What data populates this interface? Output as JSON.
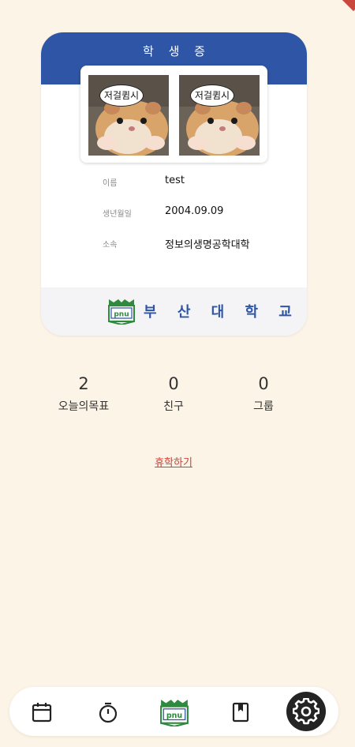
{
  "card": {
    "title": "학 생 증",
    "photo_caption": "저걸큄시",
    "fields": [
      {
        "label": "이름",
        "value": "test"
      },
      {
        "label": "생년월일",
        "value": "2004.09.09"
      },
      {
        "label": "소속",
        "value": "정보의생명공학대학"
      }
    ],
    "university_name": "부 산 대 학 교",
    "logo_text": "pnu"
  },
  "stats": [
    {
      "value": "2",
      "label": "오늘의목표"
    },
    {
      "value": "0",
      "label": "친구"
    },
    {
      "value": "0",
      "label": "그룹"
    }
  ],
  "leave_link": "휴학하기",
  "nav": {
    "items": [
      {
        "icon": "calendar-icon"
      },
      {
        "icon": "timer-icon"
      },
      {
        "icon": "university-logo-icon",
        "active": true
      },
      {
        "icon": "bookmark-book-icon"
      },
      {
        "icon": "gear-icon"
      }
    ]
  },
  "colors": {
    "background": "#fcf4e6",
    "card_header": "#2f55a6",
    "university_text": "#2f55a6",
    "logo_green": "#2f8a3e",
    "link_red": "#d0413a",
    "settings_button": "#242424"
  }
}
